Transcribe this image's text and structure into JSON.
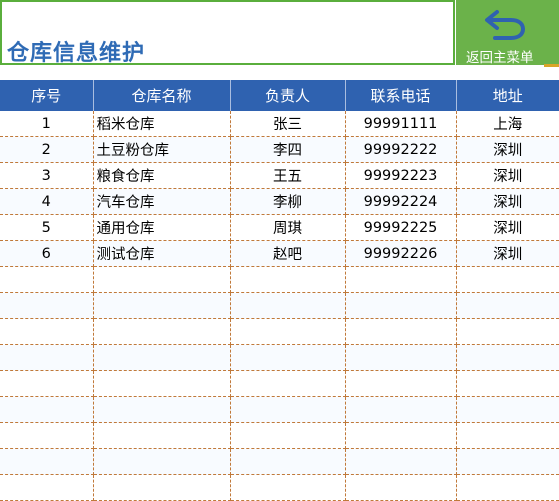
{
  "header": {
    "title": "仓库信息维护",
    "back_label": "返回主菜单"
  },
  "colors": {
    "title_text": "#2f6bb5",
    "header_bg": "#2f62b0",
    "back_button_bg": "#6bb24a",
    "title_border": "#5aae3c",
    "grid_line": "#c0793a"
  },
  "table": {
    "columns": [
      "序号",
      "仓库名称",
      "负责人",
      "联系电话",
      "地址"
    ],
    "rows": [
      [
        "1",
        "稻米仓库",
        "张三",
        "99991111",
        "上海"
      ],
      [
        "2",
        "土豆粉仓库",
        "李四",
        "99992222",
        "深圳"
      ],
      [
        "3",
        "粮食仓库",
        "王五",
        "99992223",
        "深圳"
      ],
      [
        "4",
        "汽车仓库",
        "李柳",
        "99992224",
        "深圳"
      ],
      [
        "5",
        "通用仓库",
        "周琪",
        "99992225",
        "深圳"
      ],
      [
        "6",
        "测试仓库",
        "赵吧",
        "99992226",
        "深圳"
      ],
      [
        "",
        "",
        "",
        "",
        ""
      ],
      [
        "",
        "",
        "",
        "",
        ""
      ],
      [
        "",
        "",
        "",
        "",
        ""
      ],
      [
        "",
        "",
        "",
        "",
        ""
      ],
      [
        "",
        "",
        "",
        "",
        ""
      ],
      [
        "",
        "",
        "",
        "",
        ""
      ],
      [
        "",
        "",
        "",
        "",
        ""
      ],
      [
        "",
        "",
        "",
        "",
        ""
      ],
      [
        "",
        "",
        "",
        "",
        ""
      ]
    ]
  }
}
